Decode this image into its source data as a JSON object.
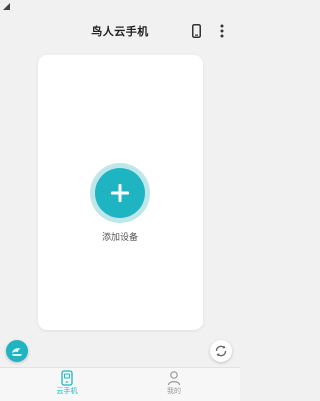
{
  "header": {
    "title": "鸟人云手机",
    "icons": [
      "phone-icon",
      "more-vertical-icon"
    ]
  },
  "main": {
    "add_device_label": "添加设备"
  },
  "floating": {
    "left_icon": "app-logo-icon",
    "right_icon": "refresh-icon"
  },
  "bottom_nav": {
    "items": [
      {
        "label": "云手机",
        "icon": "cloud-phone-icon",
        "active": true
      },
      {
        "label": "我的",
        "icon": "person-icon",
        "active": false
      }
    ]
  },
  "colors": {
    "accent": "#1fb4c2",
    "accent_light": "#bfe7ea",
    "background": "#f1f1f1"
  }
}
